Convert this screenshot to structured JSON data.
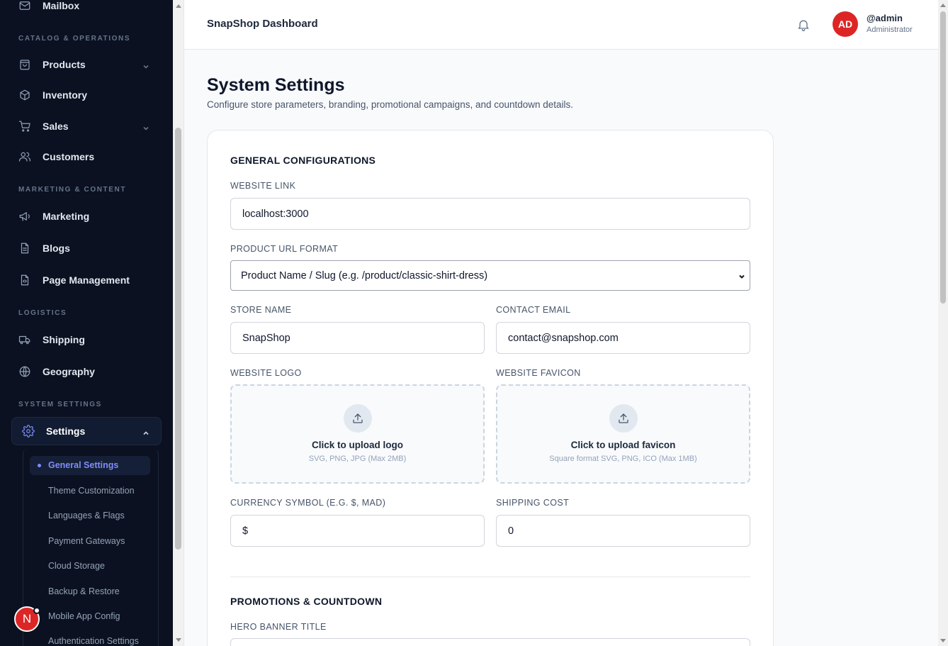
{
  "sidebar": {
    "mailbox": "Mailbox",
    "sections": {
      "catalog": "CATALOG & OPERATIONS",
      "marketing": "MARKETING & CONTENT",
      "logistics": "LOGISTICS",
      "system": "SYSTEM SETTINGS"
    },
    "items": {
      "products": "Products",
      "inventory": "Inventory",
      "sales": "Sales",
      "customers": "Customers",
      "marketing": "Marketing",
      "blogs": "Blogs",
      "page_management": "Page Management",
      "shipping": "Shipping",
      "geography": "Geography",
      "settings": "Settings"
    },
    "submenu": [
      "General Settings",
      "Theme Customization",
      "Languages & Flags",
      "Payment Gateways",
      "Cloud Storage",
      "Backup & Restore",
      "Mobile App Config",
      "Authentication Settings"
    ],
    "badge_letter": "N"
  },
  "header": {
    "title": "SnapShop Dashboard",
    "avatar_initials": "AD",
    "username": "@admin",
    "role": "Administrator"
  },
  "page": {
    "title": "System Settings",
    "subtitle": "Configure store parameters, branding, promotional campaigns, and countdown details."
  },
  "general": {
    "section_title": "GENERAL CONFIGURATIONS",
    "website_link_label": "WEBSITE LINK",
    "website_link_value": "localhost:3000",
    "url_format_label": "PRODUCT URL FORMAT",
    "url_format_value": "Product Name / Slug (e.g. /product/classic-shirt-dress)",
    "store_name_label": "STORE NAME",
    "store_name_value": "SnapShop",
    "contact_email_label": "CONTACT EMAIL",
    "contact_email_value": "contact@snapshop.com",
    "logo_label": "WEBSITE LOGO",
    "logo_upload_title": "Click to upload logo",
    "logo_upload_hint": "SVG, PNG, JPG (Max 2MB)",
    "favicon_label": "WEBSITE FAVICON",
    "favicon_upload_title": "Click to upload favicon",
    "favicon_upload_hint": "Square format SVG, PNG, ICO (Max 1MB)",
    "currency_label": "CURRENCY SYMBOL (E.G. $, MAD)",
    "currency_value": "$",
    "shipping_label": "SHIPPING COST",
    "shipping_value": "0"
  },
  "promotions": {
    "section_title": "PROMOTIONS & COUNTDOWN",
    "hero_title_label": "HERO BANNER TITLE"
  },
  "icons": {
    "mailbox": "mail-icon",
    "products": "bag-icon",
    "inventory": "box-icon",
    "sales": "cart-icon",
    "customers": "users-icon",
    "marketing": "megaphone-icon",
    "blogs": "document-icon",
    "page_management": "file-code-icon",
    "shipping": "truck-icon",
    "geography": "globe-icon",
    "settings": "gear-icon",
    "notifications": "bell-icon",
    "upload": "upload-icon"
  },
  "colors": {
    "sidebar_bg": "#0b1120",
    "accent": "#818cf8",
    "avatar": "#dc2626"
  }
}
